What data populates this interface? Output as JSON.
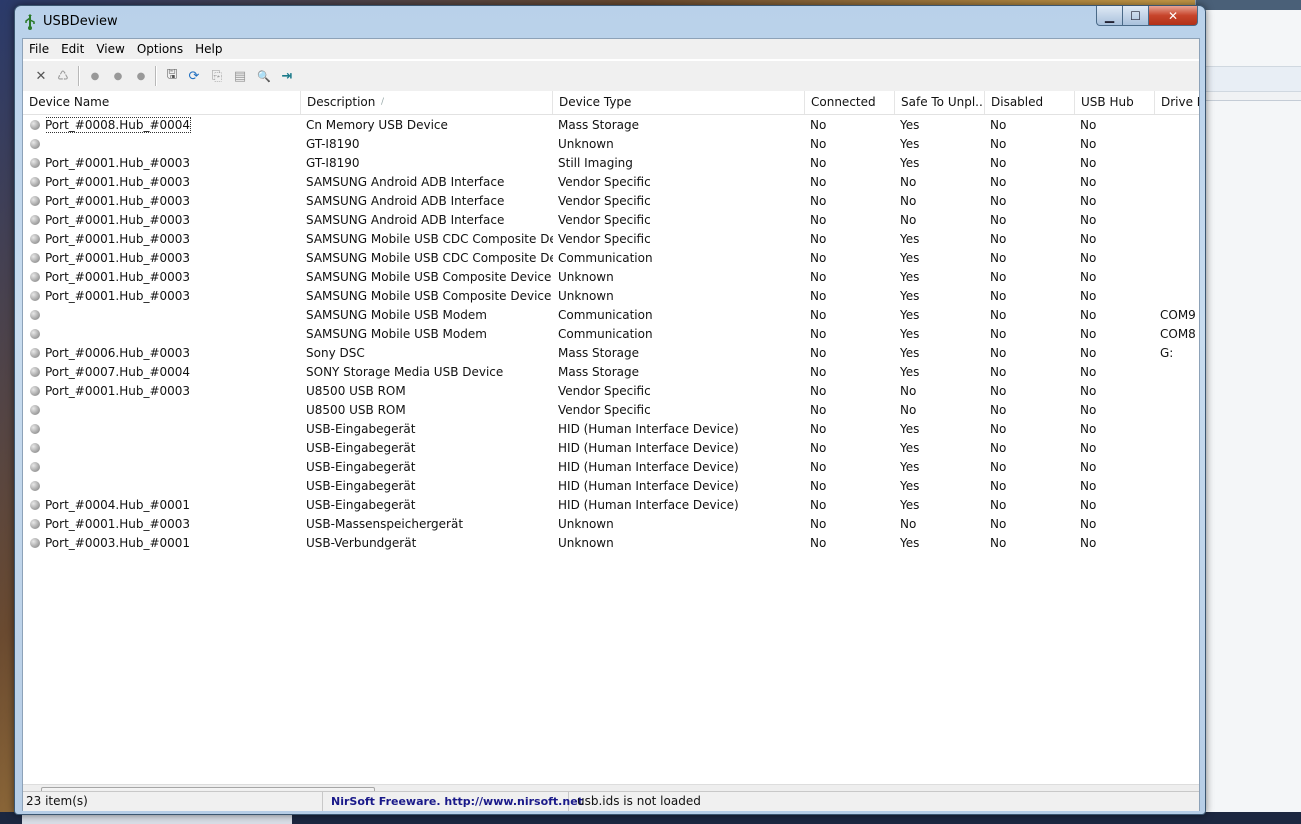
{
  "window": {
    "title": "USBDeview",
    "min_symbol": "▁",
    "max_symbol": "☐",
    "close_symbol": "✕"
  },
  "menu": [
    "File",
    "Edit",
    "View",
    "Options",
    "Help"
  ],
  "toolbar": {
    "buttons": [
      {
        "icon": "delete-icon",
        "glyph": "✕"
      },
      {
        "icon": "uninstall-icon",
        "glyph": "♺"
      },
      {
        "icon": "disconnect-icon",
        "glyph": "●"
      },
      {
        "icon": "enable-icon",
        "glyph": "●"
      },
      {
        "icon": "disable-icon",
        "glyph": "●"
      },
      {
        "icon": "save-icon",
        "glyph": "🖫"
      },
      {
        "icon": "refresh-icon",
        "glyph": "⟳"
      },
      {
        "icon": "copy-icon",
        "glyph": "⎘"
      },
      {
        "icon": "properties-icon",
        "glyph": "▤"
      },
      {
        "icon": "find-icon",
        "glyph": "🔍"
      },
      {
        "icon": "exit-icon",
        "glyph": "⇥"
      }
    ]
  },
  "columns": [
    "Device Name",
    "Description",
    "Device Type",
    "Connected",
    "Safe To Unpl...",
    "Disabled",
    "USB Hub",
    "Drive L"
  ],
  "rows": [
    [
      "Port_#0008.Hub_#0004",
      "Cn Memory USB Device",
      "Mass Storage",
      "No",
      "Yes",
      "No",
      "No",
      ""
    ],
    [
      "",
      "GT-I8190",
      "Unknown",
      "No",
      "Yes",
      "No",
      "No",
      ""
    ],
    [
      "Port_#0001.Hub_#0003",
      "GT-I8190",
      "Still Imaging",
      "No",
      "Yes",
      "No",
      "No",
      ""
    ],
    [
      "Port_#0001.Hub_#0003",
      "SAMSUNG Android ADB Interface",
      "Vendor Specific",
      "No",
      "No",
      "No",
      "No",
      ""
    ],
    [
      "Port_#0001.Hub_#0003",
      "SAMSUNG Android ADB Interface",
      "Vendor Specific",
      "No",
      "No",
      "No",
      "No",
      ""
    ],
    [
      "Port_#0001.Hub_#0003",
      "SAMSUNG Android ADB Interface",
      "Vendor Specific",
      "No",
      "No",
      "No",
      "No",
      ""
    ],
    [
      "Port_#0001.Hub_#0003",
      "SAMSUNG Mobile USB CDC Composite Dev...",
      "Vendor Specific",
      "No",
      "Yes",
      "No",
      "No",
      ""
    ],
    [
      "Port_#0001.Hub_#0003",
      "SAMSUNG Mobile USB CDC Composite Dev...",
      "Communication",
      "No",
      "Yes",
      "No",
      "No",
      ""
    ],
    [
      "Port_#0001.Hub_#0003",
      "SAMSUNG Mobile USB Composite Device",
      "Unknown",
      "No",
      "Yes",
      "No",
      "No",
      ""
    ],
    [
      "Port_#0001.Hub_#0003",
      "SAMSUNG Mobile USB Composite Device",
      "Unknown",
      "No",
      "Yes",
      "No",
      "No",
      ""
    ],
    [
      "",
      "SAMSUNG Mobile USB Modem",
      "Communication",
      "No",
      "Yes",
      "No",
      "No",
      "COM9"
    ],
    [
      "",
      "SAMSUNG Mobile USB Modem",
      "Communication",
      "No",
      "Yes",
      "No",
      "No",
      "COM8"
    ],
    [
      "Port_#0006.Hub_#0003",
      "Sony DSC",
      "Mass Storage",
      "No",
      "Yes",
      "No",
      "No",
      "G:"
    ],
    [
      "Port_#0007.Hub_#0004",
      "SONY Storage Media USB Device",
      "Mass Storage",
      "No",
      "Yes",
      "No",
      "No",
      ""
    ],
    [
      "Port_#0001.Hub_#0003",
      "U8500 USB ROM",
      "Vendor Specific",
      "No",
      "No",
      "No",
      "No",
      ""
    ],
    [
      "",
      "U8500 USB ROM",
      "Vendor Specific",
      "No",
      "No",
      "No",
      "No",
      ""
    ],
    [
      "",
      "USB-Eingabegerät",
      "HID (Human Interface Device)",
      "No",
      "Yes",
      "No",
      "No",
      ""
    ],
    [
      "",
      "USB-Eingabegerät",
      "HID (Human Interface Device)",
      "No",
      "Yes",
      "No",
      "No",
      ""
    ],
    [
      "",
      "USB-Eingabegerät",
      "HID (Human Interface Device)",
      "No",
      "Yes",
      "No",
      "No",
      ""
    ],
    [
      "",
      "USB-Eingabegerät",
      "HID (Human Interface Device)",
      "No",
      "Yes",
      "No",
      "No",
      ""
    ],
    [
      "Port_#0004.Hub_#0001",
      "USB-Eingabegerät",
      "HID (Human Interface Device)",
      "No",
      "Yes",
      "No",
      "No",
      ""
    ],
    [
      "Port_#0001.Hub_#0003",
      "USB-Massenspeichergerät",
      "Unknown",
      "No",
      "No",
      "No",
      "No",
      ""
    ],
    [
      "Port_#0003.Hub_#0001",
      "USB-Verbundgerät",
      "Unknown",
      "No",
      "Yes",
      "No",
      "No",
      ""
    ]
  ],
  "status": {
    "count": "23 item(s)",
    "link": "NirSoft Freeware.  http://www.nirsoft.net",
    "note": "usb.ids is not loaded"
  },
  "scroll": {
    "grip": "III",
    "left": "◀",
    "right": "▶"
  }
}
